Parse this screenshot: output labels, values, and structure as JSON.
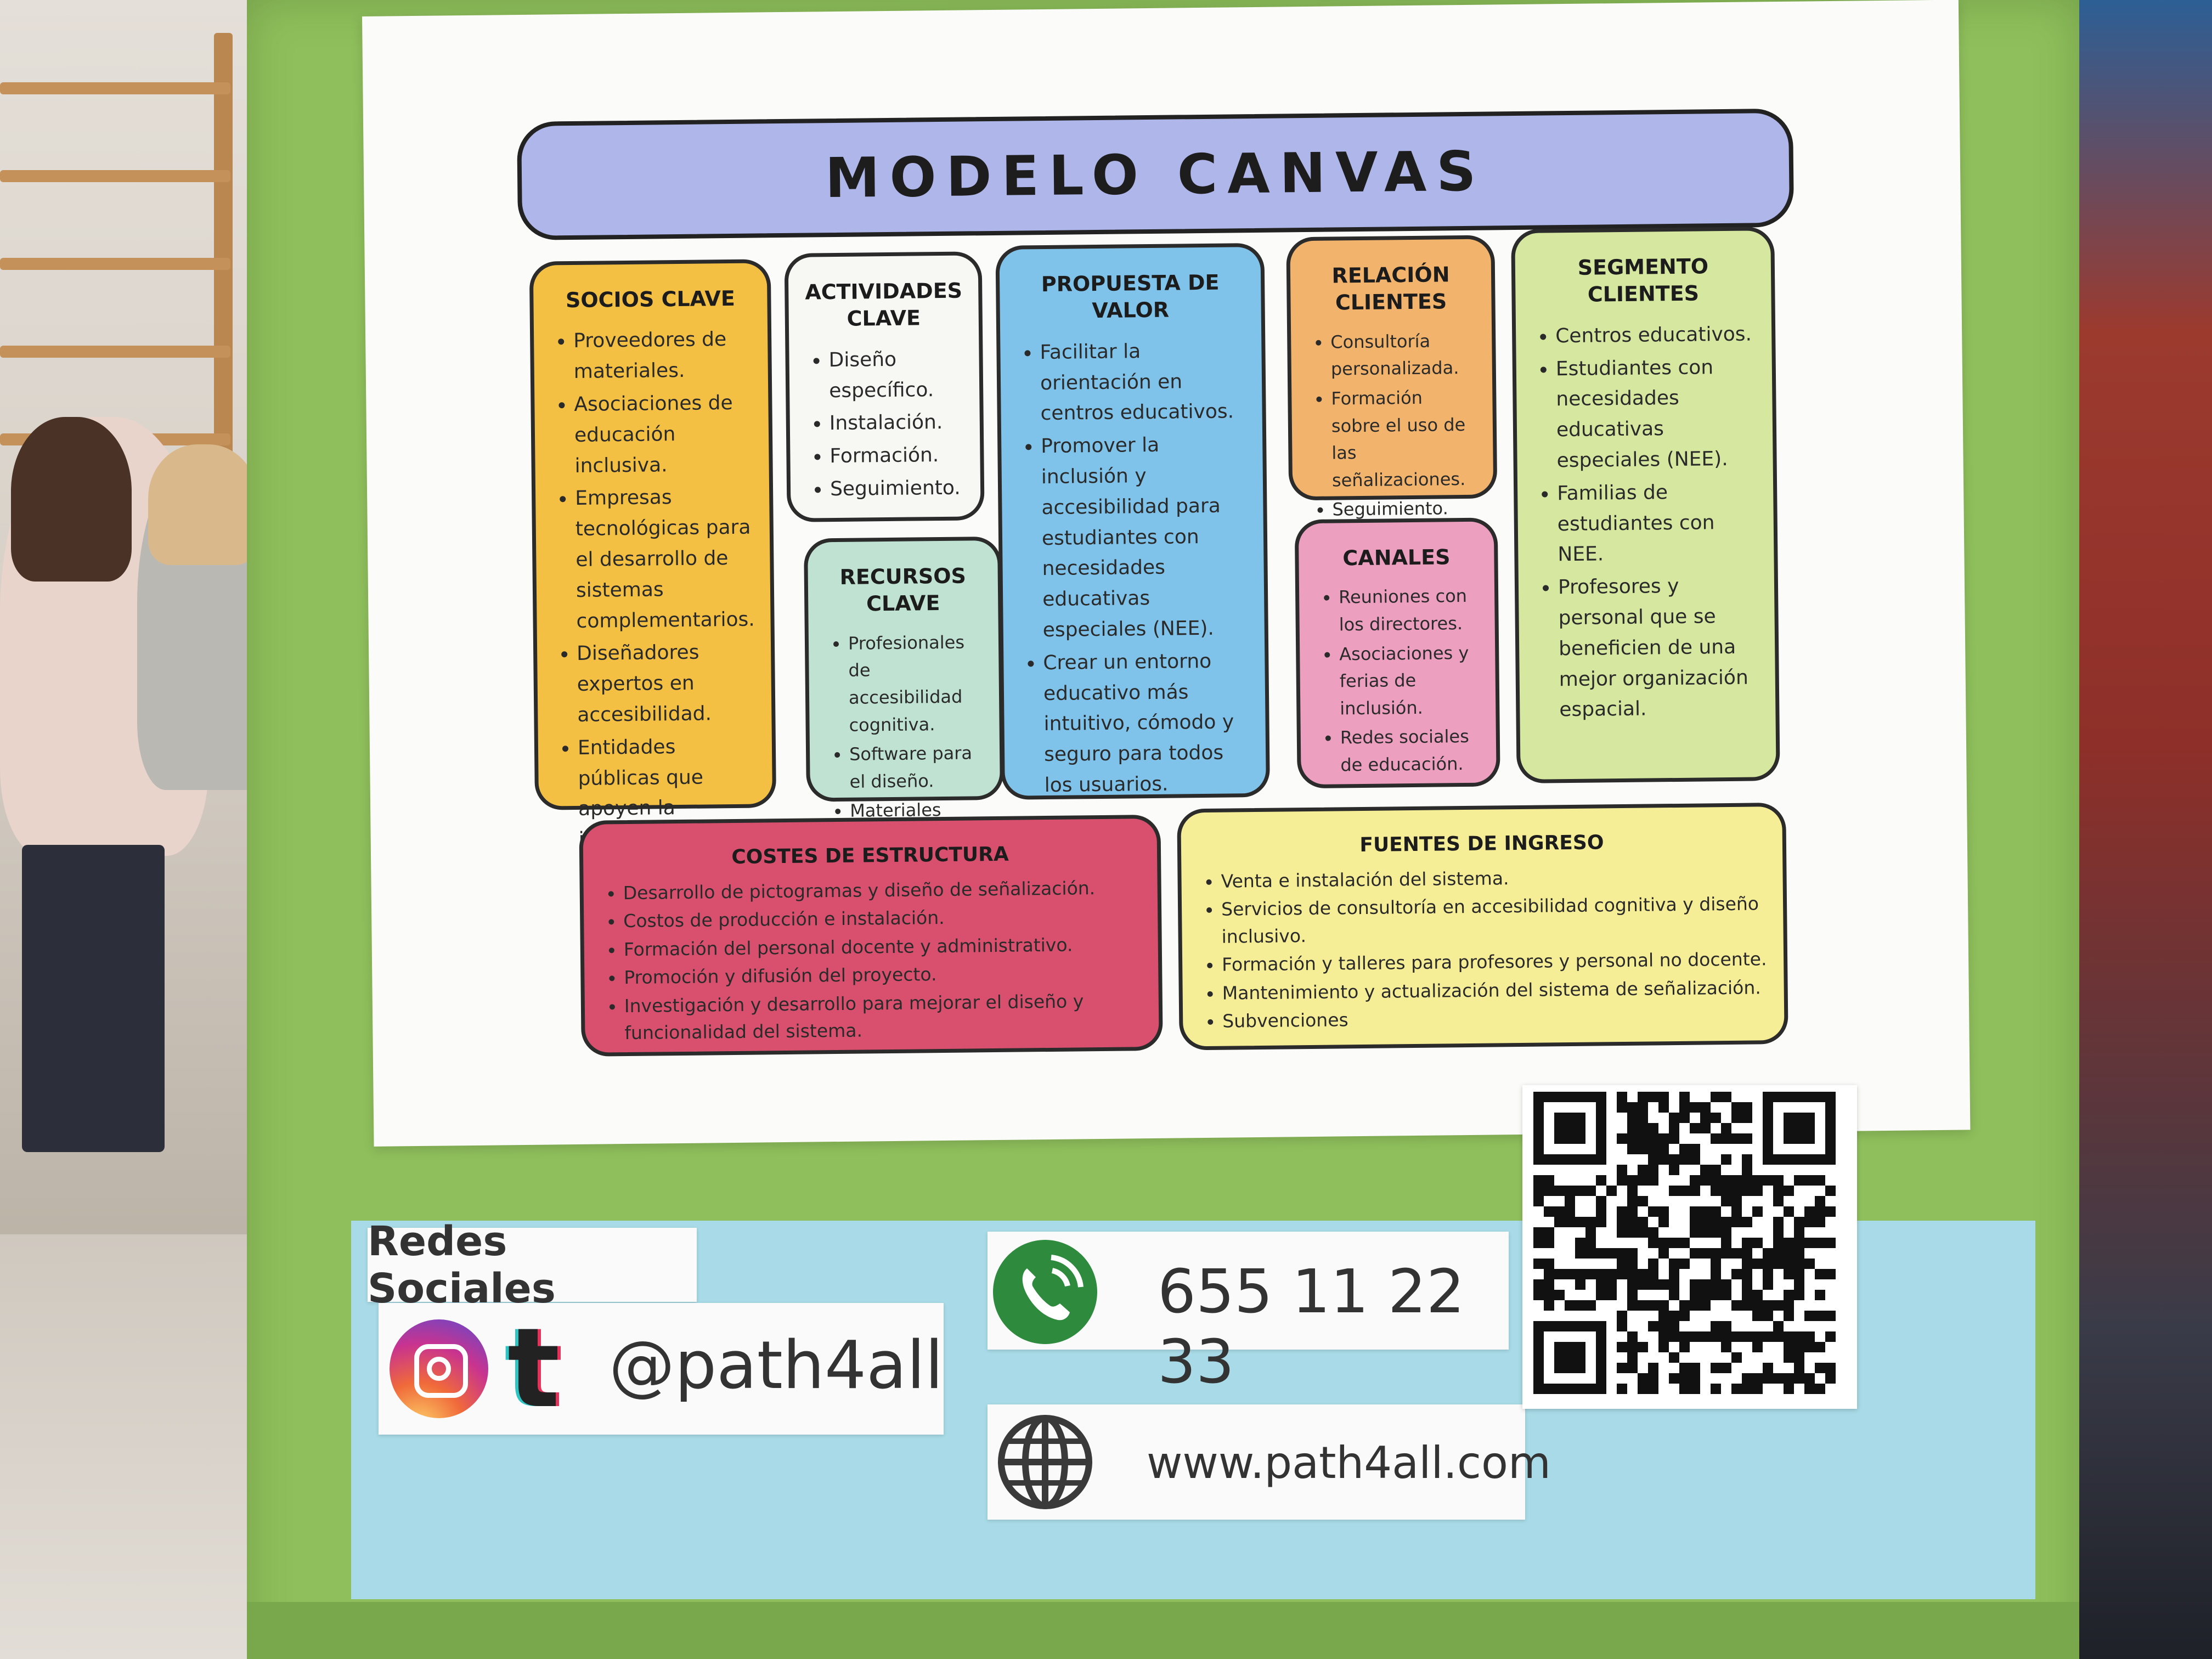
{
  "poster": {
    "title": "MODELO CANVAS",
    "socios": {
      "heading": "SOCIOS CLAVE",
      "items": [
        "Proveedores de materiales.",
        "Asociaciones de educación inclusiva.",
        "Empresas tecnológicas para el desarrollo de sistemas complementarios.",
        "Diseñadores expertos en accesibilidad.",
        "Entidades públicas que apoyen la inclusión educativa."
      ],
      "color": "#f3c044"
    },
    "actividades": {
      "heading": "ACTIVIDADES CLAVE",
      "items": [
        "Diseño específico.",
        "Instalación.",
        "Formación.",
        "Seguimiento."
      ],
      "color": "#f7f7f4"
    },
    "recursos": {
      "heading": "RECURSOS CLAVE",
      "items": [
        "Profesionales de accesibilidad cognitiva.",
        "Software para el diseño.",
        "Materiales duraderos."
      ],
      "color": "#bfe2d2"
    },
    "propuesta": {
      "heading": "PROPUESTA DE VALOR",
      "items": [
        "Facilitar la orientación en centros educativos.",
        "Promover la inclusión y accesibilidad para estudiantes con necesidades educativas especiales (NEE).",
        "Crear un entorno educativo más intuitivo, cómodo y seguro para todos los usuarios."
      ],
      "color": "#7fc3ea"
    },
    "relacion": {
      "heading": "RELACIÓN CLIENTES",
      "items": [
        "Consultoría personalizada.",
        "Formación sobre el uso de las señalizaciones.",
        "Seguimiento."
      ],
      "color": "#f2b46c"
    },
    "canales": {
      "heading": "CANALES",
      "items": [
        "Reuniones con los directores.",
        "Asociaciones y ferias de inclusión.",
        "Redes sociales de educación."
      ],
      "color": "#ec9fbf"
    },
    "segmento": {
      "heading": "SEGMENTO CLIENTES",
      "items": [
        "Centros educativos.",
        "Estudiantes con necesidades educativas especiales (NEE).",
        "Familias de estudiantes con NEE.",
        "Profesores y personal que se beneficien de una mejor organización espacial."
      ],
      "color": "#d6e8a0"
    },
    "costes": {
      "heading": "COSTES DE ESTRUCTURA",
      "items": [
        "Desarrollo de pictogramas y diseño de señalización.",
        "Costos de producción e instalación.",
        "Formación del personal docente y administrativo.",
        "Promoción y difusión del proyecto.",
        "Investigación y desarrollo para mejorar el diseño y funcionalidad del sistema."
      ],
      "color": "#d9506e"
    },
    "fuentes": {
      "heading": "FUENTES DE INGRESO",
      "items": [
        "Venta e instalación del sistema.",
        "Servicios de consultoría en accesibilidad cognitiva y diseño inclusivo.",
        "Formación y talleres para profesores y personal no docente.",
        "Mantenimiento y actualización del sistema de señalización.",
        "Subvenciones"
      ],
      "color": "#f6ee96"
    }
  },
  "contact": {
    "social_label": "Redes Sociales",
    "handle": "@path4all",
    "phone": "655 11 22 33",
    "website": "www.path4all.com",
    "icons": [
      "instagram-icon",
      "tumblr-icon",
      "phone-icon",
      "globe-icon",
      "qr-code"
    ],
    "phone_color": "#2e8b3e",
    "box_color": "#8fbf5c",
    "band_color": "#a8dbe7"
  }
}
